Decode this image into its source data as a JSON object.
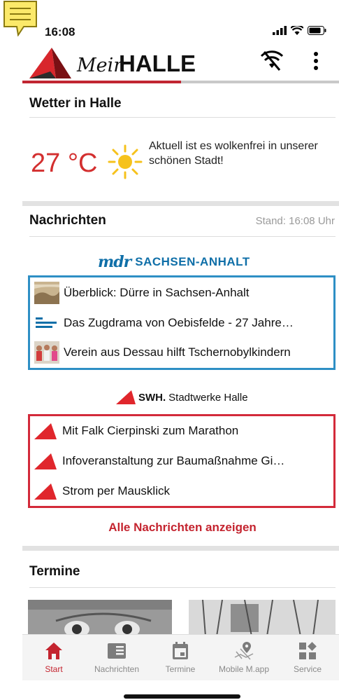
{
  "status_bar": {
    "time": "16:08"
  },
  "app": {
    "brand_script": "Mein",
    "brand_bold": "HALLE",
    "progress_fraction": 0.5
  },
  "weather": {
    "title": "Wetter in Halle",
    "temperature": "27 °C",
    "description": "Aktuell ist es wolkenfrei in unserer schönen Stadt!"
  },
  "news": {
    "title": "Nachrichten",
    "stand": "Stand: 16:08 Uhr",
    "mdr": {
      "logo_mark": "mdr",
      "logo_name": "SACHSEN-ANHALT",
      "items": [
        {
          "title": "Überblick: Dürre in Sachsen-Anhalt",
          "thumb": "landscape-thumb"
        },
        {
          "title": "Das Zugdrama von Oebisfelde - 27 Jahre…",
          "thumb": "mdr-sachsen-anhalt-thumb"
        },
        {
          "title": "Verein aus Dessau hilft Tschernobylkindern",
          "thumb": "group-photo-thumb"
        }
      ]
    },
    "swh": {
      "logo_short": "SWH.",
      "logo_name": "Stadtwerke Halle",
      "items": [
        {
          "title": "Mit Falk Cierpinski zum Marathon"
        },
        {
          "title": "Infoveranstaltung zur Baumaßnahme Gi…"
        },
        {
          "title": "Strom per Mausklick"
        }
      ]
    },
    "all_link": "Alle Nachrichten anzeigen"
  },
  "events": {
    "title": "Termine"
  },
  "tabs": [
    {
      "label": "Start",
      "icon": "home-icon",
      "active": true
    },
    {
      "label": "Nachrichten",
      "icon": "newspaper-icon",
      "active": false
    },
    {
      "label": "Termine",
      "icon": "calendar-icon",
      "active": false
    },
    {
      "label": "Mobile M.app",
      "icon": "map-pin-icon",
      "active": false
    },
    {
      "label": "Service",
      "icon": "service-grid-icon",
      "active": false
    }
  ],
  "colors": {
    "accent": "#c4242f",
    "mdr_blue": "#2e8fc5",
    "swh_red": "#d32a3a",
    "temp_red": "#d32f2f"
  }
}
